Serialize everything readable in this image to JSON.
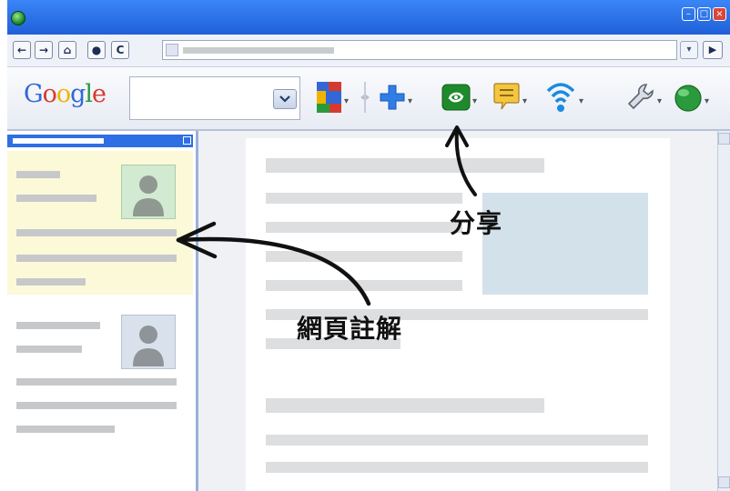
{
  "toolbar": {
    "logo_text": "Google"
  },
  "callouts": {
    "share_label": "分享",
    "annotation_label": "網頁註解"
  },
  "icons": {
    "google_logo_colors": [
      "#3367d6",
      "#d63a2f",
      "#f0b400",
      "#3367d6",
      "#2a9a3c",
      "#d63a2f"
    ],
    "share_color": "#1f8a2b",
    "plus_color": "#2f7ee6",
    "sidebar_header_color": "#2f6fe4"
  }
}
